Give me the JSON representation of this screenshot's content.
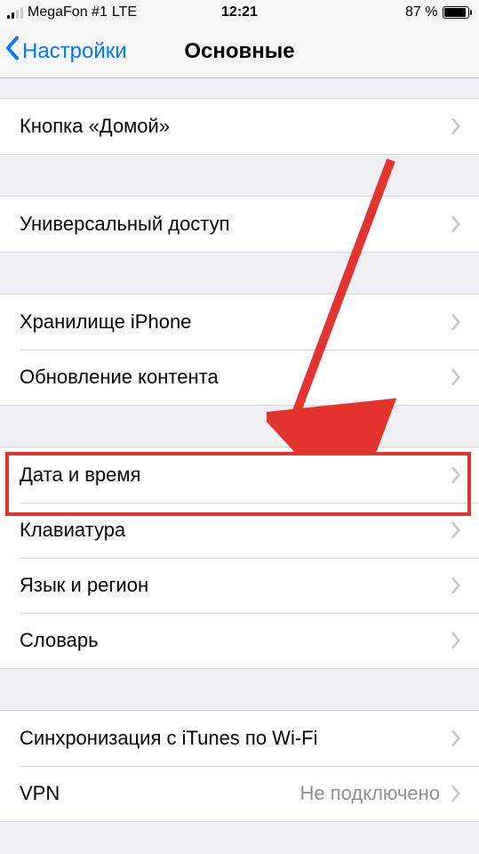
{
  "statusbar": {
    "carrier": "MegaFon #1",
    "network": "LTE",
    "time": "12:21",
    "battery_pct": "87 %"
  },
  "nav": {
    "back_label": "Настройки",
    "title": "Основные"
  },
  "groups": [
    {
      "rows": [
        {
          "label": "Кнопка «Домой»"
        }
      ]
    },
    {
      "rows": [
        {
          "label": "Универсальный доступ"
        }
      ]
    },
    {
      "rows": [
        {
          "label": "Хранилище iPhone"
        },
        {
          "label": "Обновление контента"
        }
      ]
    },
    {
      "rows": [
        {
          "label": "Дата и время",
          "highlighted": true
        },
        {
          "label": "Клавиатура"
        },
        {
          "label": "Язык и регион"
        },
        {
          "label": "Словарь"
        }
      ]
    },
    {
      "rows": [
        {
          "label": "Синхронизация с iTunes по Wi-Fi"
        },
        {
          "label": "VPN",
          "value": "Не подключено"
        }
      ]
    }
  ]
}
